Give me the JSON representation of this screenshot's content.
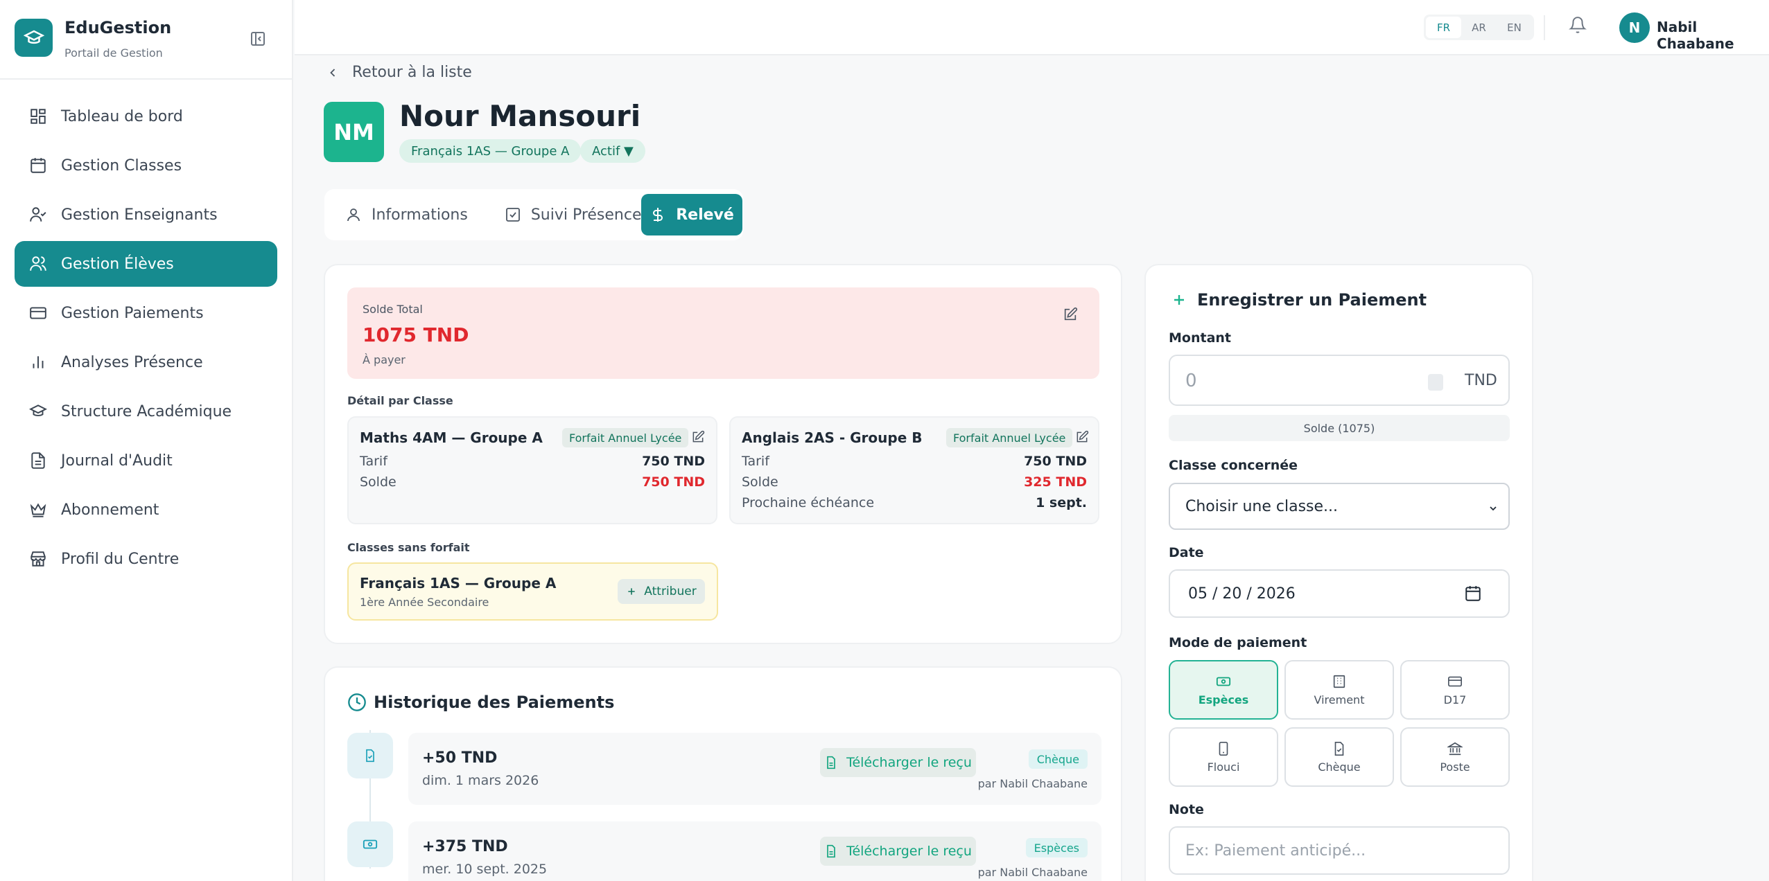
{
  "app": {
    "title": "EduGestion",
    "subtitle": "Portail de Gestion"
  },
  "sidebar": {
    "items": [
      {
        "label": "Tableau de bord",
        "icon": "dashboard-icon"
      },
      {
        "label": "Gestion Classes",
        "icon": "calendar-icon"
      },
      {
        "label": "Gestion Enseignants",
        "icon": "user-check-icon"
      },
      {
        "label": "Gestion Élèves",
        "icon": "users-icon",
        "active": true
      },
      {
        "label": "Gestion Paiements",
        "icon": "credit-card-icon"
      },
      {
        "label": "Analyses Présence",
        "icon": "bar-chart-icon"
      },
      {
        "label": "Structure Académique",
        "icon": "graduation-cap-icon"
      },
      {
        "label": "Journal d'Audit",
        "icon": "file-text-icon"
      },
      {
        "label": "Abonnement",
        "icon": "crown-icon"
      },
      {
        "label": "Profil du Centre",
        "icon": "store-icon"
      }
    ]
  },
  "topbar": {
    "languages": [
      "FR",
      "AR",
      "EN"
    ],
    "selected_language": "FR",
    "user_initial": "N",
    "user_name": "Nabil Chaabane"
  },
  "page": {
    "back_label": "Retour à la liste",
    "student_initials": "NM",
    "student_name": "Nour Mansouri",
    "class_chip": "Français 1AS — Groupe A",
    "status_chip": "Actif ▼"
  },
  "tabs": [
    {
      "label": "Informations"
    },
    {
      "label": "Suivi Présence"
    },
    {
      "label": "Relevé",
      "active": true
    }
  ],
  "statement": {
    "balance_label": "Solde Total",
    "balance_amount": "1075 TND",
    "balance_sub": "À payer",
    "detail_title": "Détail par Classe",
    "classes": [
      {
        "name": "Maths 4AM — Groupe A",
        "badge": "Forfait Annuel Lycée",
        "rows": [
          {
            "label": "Tarif",
            "value": "750 TND"
          },
          {
            "label": "Solde",
            "value": "750 TND"
          }
        ]
      },
      {
        "name": "Anglais 2AS - Groupe B",
        "badge": "Forfait Annuel Lycée",
        "rows": [
          {
            "label": "Tarif",
            "value": "750 TND"
          },
          {
            "label": "Solde",
            "value": "325 TND"
          },
          {
            "label": "Prochaine échéance",
            "value": "1 sept."
          }
        ]
      }
    ],
    "no_plan_title": "Classes sans forfait",
    "no_plan": {
      "name": "Français 1AS — Groupe A",
      "sub": "1ère Année Secondaire",
      "button": "Attribuer"
    }
  },
  "history": {
    "title": "Historique des Paiements",
    "receipt_label": "Télécharger le reçu",
    "items": [
      {
        "amount": "+50 TND",
        "date": "dim. 1 mars 2026",
        "mode": "Chèque",
        "by": "par Nabil Chaabane"
      },
      {
        "amount": "+375 TND",
        "date": "mer. 10 sept. 2025",
        "mode": "Espèces",
        "by": "par Nabil Chaabane"
      }
    ]
  },
  "payment_form": {
    "title": "Enregistrer un Paiement",
    "amount_label": "Montant",
    "amount_placeholder": "0",
    "currency": "TND",
    "solde_hint": "Solde (1075)",
    "class_label": "Classe concernée",
    "class_select": "Choisir une classe...",
    "date_label": "Date",
    "date_value": "05 / 20 / 2026",
    "mode_label": "Mode de paiement",
    "modes": [
      {
        "label": "Espèces",
        "selected": true
      },
      {
        "label": "Virement"
      },
      {
        "label": "D17"
      },
      {
        "label": "Flouci"
      },
      {
        "label": "Chèque"
      },
      {
        "label": "Poste"
      }
    ],
    "note_label": "Note",
    "note_placeholder": "Ex: Paiement anticipé..."
  },
  "colors": {
    "primary": "#168b8f",
    "danger": "#e0282e",
    "success": "#12a57f"
  }
}
